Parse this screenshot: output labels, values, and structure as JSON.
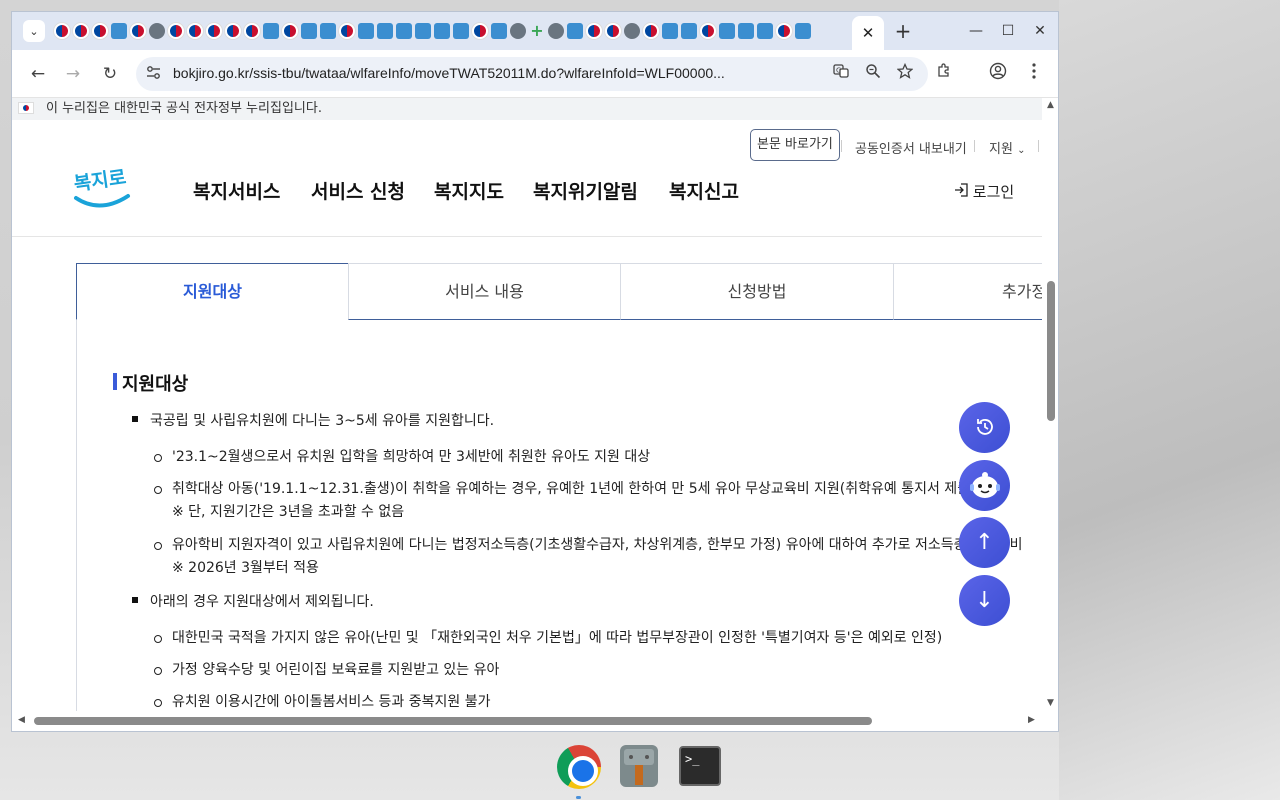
{
  "browser": {
    "tab_search_glyph": "⌄",
    "active_tab_close": "✕",
    "new_tab": "+",
    "window_controls": {
      "minimize": "—",
      "maximize": "☐",
      "close": "✕"
    },
    "nav": {
      "back": "←",
      "forward": "→",
      "reload": "↻"
    },
    "url": "bokjiro.go.kr/ssis-tbu/twataa/wlfareInfo/moveTWAT52011M.do?wlfareInfoId=WLF00000...",
    "icons": {
      "translate": "translate-icon",
      "zoom": "zoom-icon",
      "bookmark": "star-icon",
      "extensions": "puzzle-icon",
      "profile": "profile-icon",
      "menu": "kebab-menu-icon"
    }
  },
  "page": {
    "gov_banner": "이 누리집은 대한민국 공식 전자정부 누리집입니다.",
    "utility": {
      "skip_link": "본문 바로가기",
      "cert_export": "공동인증서 내보내기",
      "region": "지원"
    },
    "logo_text": "복지로",
    "gnb": [
      "복지서비스",
      "서비스 신청",
      "복지지도",
      "복지위기알림",
      "복지신고"
    ],
    "login": "로그인",
    "content_tabs": [
      "지원대상",
      "서비스 내용",
      "신청방법",
      "추가정"
    ],
    "section_title": "지원대상",
    "list": {
      "item1": "국공립 및 사립유치원에 다니는 3~5세 유아를 지원합니다.",
      "item1_sub1": "'23.1~2월생으로서 유치원 입학을 희망하여 만 3세반에 취원한 유아도 지원 대상",
      "item1_sub2_line1": "취학대상 아동('19.1.1~12.31.출생)이 취학을 유예하는 경우, 유예한 1년에 한하여 만 5세 유아 무상교육비 지원(취학유예 통지서 제출)",
      "item1_sub2_line2": "※ 단, 지원기간은 3년을 초과할 수 없음",
      "item1_sub3_line1": "유아학비 지원자격이 있고 사립유치원에 다니는 법정저소득층(기초생활수급자, 차상위계층, 한부모 가정) 유아에 대하여 추가로 저소득층 유아학비",
      "item1_sub3_line2": "※ 2026년 3월부터 적용",
      "item2": "아래의 경우 지원대상에서 제외됩니다.",
      "item2_sub1": "대한민국 국적을 가지지 않은 유아(난민 및 「재한외국인 처우 기본법」에 따라 법무부장관이 인정한 '특별기여자 등'은 예외로 인정)",
      "item2_sub2": "가정 양육수당 및 어린이집 보육료를 지원받고 있는 유아",
      "item2_sub3": "유치원 이용시간에 아이돌봄서비스 등과 중복지원 불가"
    },
    "floating": {
      "history": "↺",
      "chatbot": "chatbot-icon",
      "top": "↑",
      "bottom": "↓"
    }
  },
  "colors": {
    "accent": "#2a5bd7",
    "float_button": "#4b57df",
    "tab_border": "#3f5e99",
    "tabstrip": "#dfe6f3"
  }
}
